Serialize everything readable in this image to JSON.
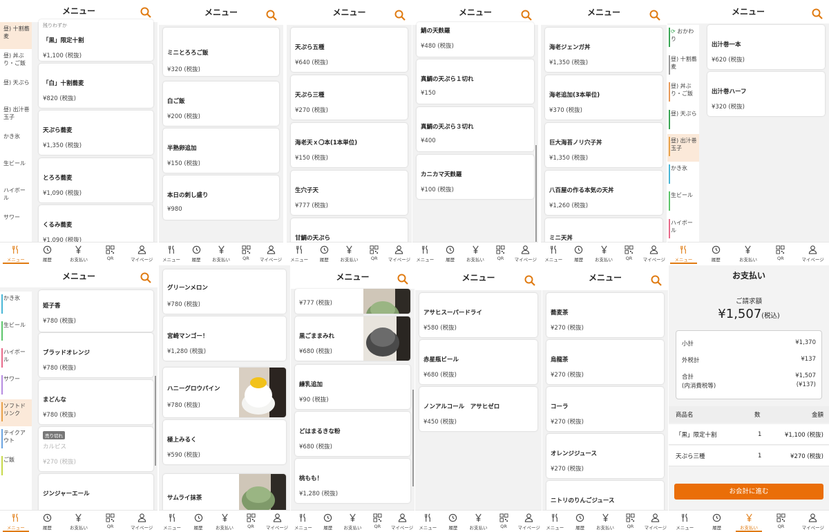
{
  "colors": {
    "accent": "#e07b12",
    "checkout": "#ea6e08",
    "side_active_bg": "#fbe9d9"
  },
  "common": {
    "header_title": "メニュー",
    "tabs": [
      {
        "label": "メニュー",
        "icon": "menu-icon"
      },
      {
        "label": "履歴",
        "icon": "history-icon"
      },
      {
        "label": "お支払い",
        "icon": "yen-icon"
      },
      {
        "label": "QR",
        "icon": "qr-icon"
      },
      {
        "label": "マイページ",
        "icon": "person-icon"
      }
    ]
  },
  "panels": [
    {
      "id": "p1",
      "title": "メニュー",
      "active_tab": 0,
      "sidebar": [
        {
          "label": "昼) 十割蕎麦",
          "active": true,
          "color": ""
        },
        {
          "label": "昼) 丼ぶり・ご飯",
          "active": false,
          "color": ""
        },
        {
          "label": "昼) 天ぷら",
          "active": false,
          "color": ""
        },
        {
          "label": "昼) 出汁巻玉子",
          "active": false,
          "color": ""
        },
        {
          "label": "かき氷",
          "active": false,
          "color": ""
        },
        {
          "label": "生ビール",
          "active": false,
          "color": ""
        },
        {
          "label": "ハイボール",
          "active": false,
          "color": ""
        },
        {
          "label": "サワー",
          "active": false,
          "color": ""
        }
      ],
      "items": [
        {
          "name": "「黒」限定十割",
          "price": "¥1,100 (税抜)",
          "note": "残りわずか"
        },
        {
          "name": "「白」十割蕎麦",
          "price": "¥820 (税抜)"
        },
        {
          "name": "天ぷら蕎麦",
          "price": "¥1,350 (税抜)"
        },
        {
          "name": "とろろ蕎麦",
          "price": "¥1,090 (税抜)"
        },
        {
          "name": "くるみ蕎麦",
          "price": "¥1,090 (税抜)"
        }
      ]
    },
    {
      "id": "p2",
      "title": "メニュー",
      "active_tab": -1,
      "items": [
        {
          "name": "ミニとろろご飯",
          "price": "¥320 (税抜)"
        },
        {
          "name": "白ご飯",
          "price": "¥200 (税抜)"
        },
        {
          "name": "半熟卵追加",
          "price": "¥150 (税抜)"
        },
        {
          "name": "本日の刺し盛り",
          "price": "¥980"
        }
      ]
    },
    {
      "id": "p3",
      "title": "メニュー",
      "active_tab": -1,
      "items": [
        {
          "name": "天ぷら五種",
          "price": "¥640 (税抜)"
        },
        {
          "name": "天ぷら三種",
          "price": "¥270 (税抜)"
        },
        {
          "name": "海老天ｘ〇本(1本単位)",
          "price": "¥150 (税抜)"
        },
        {
          "name": "生穴子天",
          "price": "¥777 (税抜)"
        },
        {
          "name": "甘鯛の天ぷら",
          "price": ""
        }
      ]
    },
    {
      "id": "p4",
      "title": "メニュー",
      "active_tab": -1,
      "items": [
        {
          "name": "鯖の天麩羅",
          "price": "¥480 (税抜)"
        },
        {
          "name": "真鯛の天ぷら１切れ",
          "price": "¥150"
        },
        {
          "name": "真鯛の天ぷら３切れ",
          "price": "¥400"
        },
        {
          "name": "カニカマ天麩羅",
          "price": "¥100 (税抜)"
        }
      ]
    },
    {
      "id": "p5",
      "title": "メニュー",
      "active_tab": -1,
      "items": [
        {
          "name": "海老ジェンガ丼",
          "price": "¥1,350 (税抜)"
        },
        {
          "name": "海老追加(3本単位)",
          "price": "¥370 (税抜)"
        },
        {
          "name": "巨大海苔ノリ穴子丼",
          "price": "¥1,350 (税抜)"
        },
        {
          "name": "八百屋の作る本気の天丼",
          "price": "¥1,260 (税抜)"
        },
        {
          "name": "ミニ天丼",
          "price": ""
        }
      ]
    },
    {
      "id": "p6",
      "title": "メニュー",
      "active_tab": 0,
      "sidebar": [
        {
          "label": "おかわり",
          "active": false,
          "color": "#3aa655",
          "icon": "refresh-icon"
        },
        {
          "label": "昼) 十割蕎麦",
          "active": false,
          "color": "#999999"
        },
        {
          "label": "昼) 丼ぶり・ご飯",
          "active": false,
          "color": "#e89a5a"
        },
        {
          "label": "昼) 天ぷら",
          "active": false,
          "color": "#3aa655"
        },
        {
          "label": "昼) 出汁巻玉子",
          "active": true,
          "color": "#e8a24a"
        },
        {
          "label": "かき氷",
          "active": false,
          "color": "#49b6d6"
        },
        {
          "label": "生ビール",
          "active": false,
          "color": "#5cc56a"
        },
        {
          "label": "ハイボール",
          "active": false,
          "color": "#e86a8a"
        }
      ],
      "items": [
        {
          "name": "出汁巻一本",
          "price": "¥620 (税抜)"
        },
        {
          "name": "出汁巻ハーフ",
          "price": "¥320 (税抜)"
        }
      ]
    },
    {
      "id": "p7",
      "title": "メニュー",
      "active_tab": 0,
      "sidebar": [
        {
          "label": "かき氷",
          "active": false,
          "color": "#49b6d6"
        },
        {
          "label": "生ビール",
          "active": false,
          "color": "#5cc56a"
        },
        {
          "label": "ハイボール",
          "active": false,
          "color": "#e86a8a"
        },
        {
          "label": "サワー",
          "active": false,
          "color": "#b58be0"
        },
        {
          "label": "ソフトドリンク",
          "active": true,
          "color": "#e8a24a"
        },
        {
          "label": "テイクアウト",
          "active": false,
          "color": "#6aa3e0"
        },
        {
          "label": "ご飯",
          "active": false,
          "color": "#c7d94a"
        }
      ],
      "items": [
        {
          "name": "姫子香",
          "price": "¥780 (税抜)"
        },
        {
          "name": "ブラッドオレンジ",
          "price": "¥780 (税抜)"
        },
        {
          "name": "まどんな",
          "price": "¥780 (税抜)"
        },
        {
          "name": "カルピス",
          "price": "¥270 (税抜)",
          "soldout": true,
          "badge": "売り切れ"
        },
        {
          "name": "ジンジャーエール",
          "price": ""
        }
      ]
    },
    {
      "id": "p8",
      "title": "メニュー",
      "active_tab": -1,
      "items": [
        {
          "name": "グリーンメロン",
          "price": "¥780 (税抜)"
        },
        {
          "name": "宮崎マンゴー！",
          "price": "¥1,280 (税抜)"
        },
        {
          "name": "ハニーグロウパイン",
          "price": "¥780 (税抜)",
          "thumb": "pine"
        },
        {
          "name": "極上みるく",
          "price": "¥590 (税抜)"
        },
        {
          "name": "サムライ抹茶",
          "price": "",
          "thumb": "matcha"
        }
      ]
    },
    {
      "id": "p9",
      "title": "メニュー",
      "active_tab": -1,
      "items": [
        {
          "name": "",
          "price": "¥777 (税抜)",
          "thumb": "matcha"
        },
        {
          "name": "黒ごままみれ",
          "price": "¥680 (税抜)",
          "thumb": "sesame"
        },
        {
          "name": "練乳追加",
          "price": "¥90 (税抜)"
        },
        {
          "name": "どはまるきな粉",
          "price": "¥680 (税抜)"
        },
        {
          "name": "桃もも！",
          "price": "¥1,280 (税抜)"
        }
      ]
    },
    {
      "id": "p10",
      "title": "メニュー",
      "active_tab": -1,
      "items": [
        {
          "name": "アサヒスーパードライ",
          "price": "¥580 (税抜)"
        },
        {
          "name": "赤星瓶ビール",
          "price": "¥680 (税抜)"
        },
        {
          "name": "ノンアルコール　アサヒゼロ",
          "price": "¥450 (税抜)"
        }
      ]
    },
    {
      "id": "p11",
      "title": "メニュー",
      "active_tab": -1,
      "items": [
        {
          "name": "蕎麦茶",
          "price": "¥270 (税抜)"
        },
        {
          "name": "烏龍茶",
          "price": "¥270 (税抜)"
        },
        {
          "name": "コーラ",
          "price": "¥270 (税抜)"
        },
        {
          "name": "オレンジジュース",
          "price": "¥270 (税抜)"
        },
        {
          "name": "ニトリのりんごジュース",
          "price": ""
        }
      ]
    }
  ],
  "payment": {
    "title": "お支払い",
    "billed_label": "ご請求額",
    "amount": "¥1,507",
    "tax_note": "(税込)",
    "subtotal_label": "小計",
    "subtotal": "¥1,370",
    "tax_label": "外税計",
    "tax": "¥137",
    "total_label": "合計",
    "total": "¥1,507",
    "incl_label": "(内消費税等)",
    "incl": "(¥137)",
    "table_head": {
      "name": "商品名",
      "qty": "数",
      "amount": "金額"
    },
    "rows": [
      {
        "name": "「黒」限定十割",
        "qty": "1",
        "amount": "¥1,100 (税抜)"
      },
      {
        "name": "天ぷら三種",
        "qty": "1",
        "amount": "¥270 (税抜)"
      }
    ],
    "checkout_label": "お会計に進む",
    "active_tab": 2
  }
}
